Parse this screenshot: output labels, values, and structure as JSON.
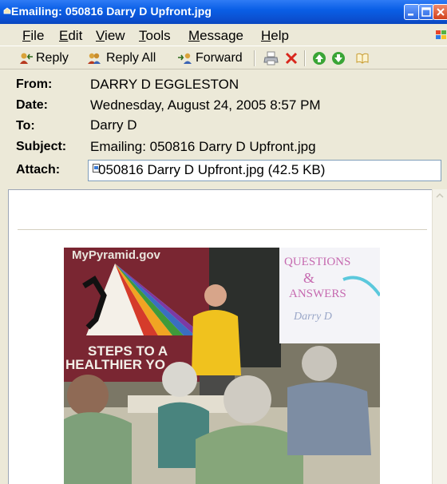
{
  "window": {
    "title": "Emailing: 050816 Darry D Upfront.jpg"
  },
  "menu": {
    "items": [
      {
        "label": "File",
        "accel": "F",
        "rest": "ile"
      },
      {
        "label": "Edit",
        "accel": "E",
        "rest": "dit"
      },
      {
        "label": "View",
        "accel": "V",
        "rest": "iew"
      },
      {
        "label": "Tools",
        "accel": "T",
        "rest": "ools"
      },
      {
        "label": "Message",
        "accel": "M",
        "rest": "essage"
      },
      {
        "label": "Help",
        "accel": "H",
        "rest": "elp"
      }
    ]
  },
  "toolbar": {
    "reply": "Reply",
    "reply_all": "Reply All",
    "forward": "Forward",
    "icons": [
      "reply-icon",
      "reply-all-icon",
      "forward-icon",
      "print-icon",
      "delete-icon",
      "previous-icon",
      "next-icon",
      "addresses-icon"
    ]
  },
  "headers": {
    "from_label": "From:",
    "from": "DARRY D EGGLESTON",
    "date_label": "Date:",
    "date": "Wednesday, August 24, 2005 8:57 PM",
    "to_label": "To:",
    "to": "Darry D",
    "subject_label": "Subject:",
    "subject": "Emailing: 050816 Darry D Upfront.jpg",
    "attach_label": "Attach:",
    "attachment": "050816 Darry D Upfront.jpg (42.5 KB)"
  },
  "photo": {
    "poster_site": "MyPyramid.gov",
    "poster_slogan_1": "STEPS TO A",
    "poster_slogan_2": "HEALTHIER YO",
    "slide_line1": "QUESTIONS",
    "slide_line2": "&",
    "slide_line3": "ANSWERS",
    "slide_line4": "Darry D"
  },
  "colors": {
    "titlebar": "#0a5fe6",
    "chrome": "#ece9d8",
    "body": "#ffffff"
  }
}
